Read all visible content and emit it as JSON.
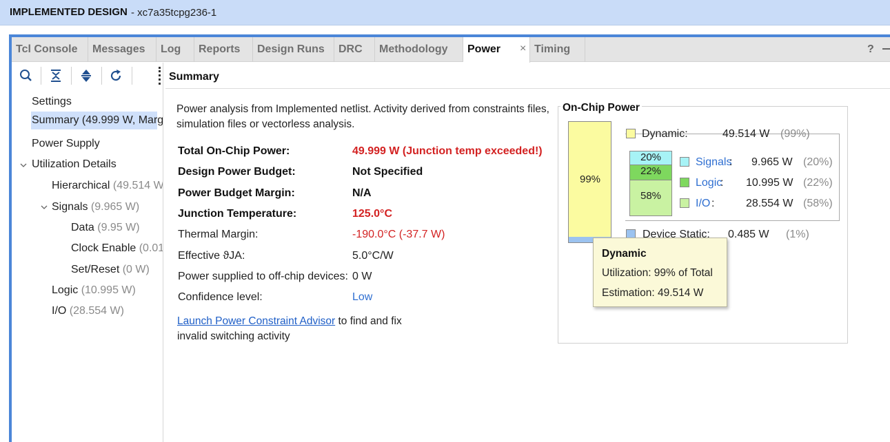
{
  "window": {
    "title": "IMPLEMENTED DESIGN",
    "part": "- xc7a35tcpg236-1"
  },
  "tabs": [
    {
      "label": "Tcl Console"
    },
    {
      "label": "Messages"
    },
    {
      "label": "Log"
    },
    {
      "label": "Reports"
    },
    {
      "label": "Design Runs"
    },
    {
      "label": "DRC"
    },
    {
      "label": "Methodology"
    },
    {
      "label": "Power",
      "active": true
    },
    {
      "label": "Timing"
    }
  ],
  "tab_close": "×",
  "tab_help": "?",
  "toolbar": {
    "icons": [
      "search-icon",
      "collapse-all-icon",
      "expand-all-icon",
      "refresh-icon"
    ]
  },
  "tree": {
    "items": [
      {
        "label": "Settings",
        "value": ""
      },
      {
        "label": "Summary (49.999 W, Marg",
        "value": ""
      },
      {
        "label": "Power Supply",
        "value": ""
      },
      {
        "label": "Utilization Details",
        "value": ""
      },
      {
        "label": "Hierarchical",
        "value": " (49.514 W"
      },
      {
        "label": "Signals",
        "value": " (9.965 W)"
      },
      {
        "label": "Data",
        "value": " (9.95 W)"
      },
      {
        "label": "Clock Enable",
        "value": " (0.01"
      },
      {
        "label": "Set/Reset",
        "value": " (0 W)"
      },
      {
        "label": "Logic",
        "value": " (10.995 W)"
      },
      {
        "label": "I/O",
        "value": " (28.554 W)"
      }
    ]
  },
  "summary": {
    "header": "Summary",
    "intro": "Power analysis from Implemented netlist. Activity derived from constraints files, simulation files or vectorless analysis.",
    "rows": [
      {
        "label": "Total On-Chip Power:",
        "value": "49.999 W (Junction temp exceeded!)"
      },
      {
        "label": "Design Power Budget:",
        "value": "Not Specified"
      },
      {
        "label": "Power Budget Margin:",
        "value": "N/A"
      },
      {
        "label": "Junction Temperature:",
        "value": "125.0°C"
      },
      {
        "label": "Thermal Margin:",
        "value": "-190.0°C (-37.7 W)"
      },
      {
        "label": "Effective ϑJA:",
        "value": "5.0°C/W"
      },
      {
        "label": "Power supplied to off-chip devices:",
        "value": "0 W"
      },
      {
        "label": "Confidence level:",
        "value": "Low"
      }
    ],
    "advisor_link": "Launch Power Constraint Advisor",
    "advisor_text": " to find and fix invalid switching activity"
  },
  "on_chip": {
    "title": "On-Chip Power",
    "bar_pct": "99%",
    "dynamic": {
      "label": "Dynamic:",
      "value": "49.514 W",
      "pct": "(99%)"
    },
    "segments": [
      {
        "pct_label": "20%",
        "name": "Signals",
        "value": "9.965 W",
        "pct": "(20%)",
        "color": "#a7f3f6"
      },
      {
        "pct_label": "22%",
        "name": "Logic",
        "value": "10.995 W",
        "pct": "(22%)",
        "color": "#7ed85e"
      },
      {
        "pct_label": "58%",
        "name": "I/O",
        "value": "28.554 W",
        "pct": "(58%)",
        "color": "#c9f2a2"
      }
    ],
    "colon": ":",
    "static": {
      "label": "Device Static:",
      "value": "0.485 W",
      "pct": "(1%)"
    }
  },
  "tooltip": {
    "title": "Dynamic",
    "utilization": "Utilization:  99% of Total",
    "estimation": "Estimation:  49.514 W"
  }
}
